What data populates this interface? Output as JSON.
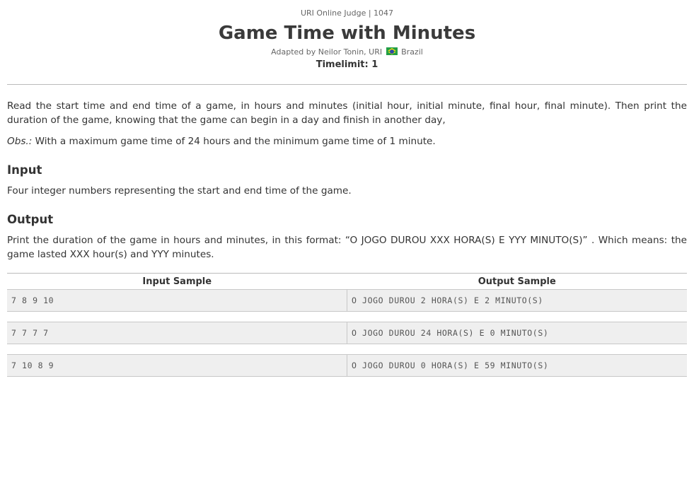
{
  "header": {
    "judge": "URI Online Judge | 1047",
    "title": "Game Time with Minutes",
    "adapted_prefix": "Adapted by Neilor Tonin, URI",
    "country": "Brazil",
    "timelimit": "Timelimit: 1"
  },
  "description": {
    "paragraph": "Read the start time and end time of a game, in hours and minutes (initial hour, initial minute, final hour, final minute). Then print the duration of the game, knowing that the game can begin in a day and finish in another day,",
    "obs_label": "Obs.:",
    "obs_text": " With a maximum game time of 24 hours and the minimum game time of 1 minute."
  },
  "input": {
    "heading": "Input",
    "text": "Four integer numbers representing the start and end time of the game."
  },
  "output": {
    "heading": "Output",
    "text": "Print the duration of the game in hours and minutes, in this format: “O JOGO DUROU XXX HORA(S) E YYY MINUTO(S)” . Which means: the game lasted XXX hour(s) and YYY minutes."
  },
  "samples": {
    "input_header": "Input Sample",
    "output_header": "Output Sample",
    "rows": [
      {
        "input": "7 8 9 10",
        "output": "O JOGO DUROU 2 HORA(S) E 2 MINUTO(S)"
      },
      {
        "input": "7 7 7 7",
        "output": "O JOGO DUROU 24 HORA(S) E 0 MINUTO(S)"
      },
      {
        "input": "7 10 8 9",
        "output": "O JOGO DUROU 0 HORA(S) E 59 MINUTO(S)"
      }
    ]
  },
  "icons": {
    "flag": "brazil-flag-icon"
  }
}
